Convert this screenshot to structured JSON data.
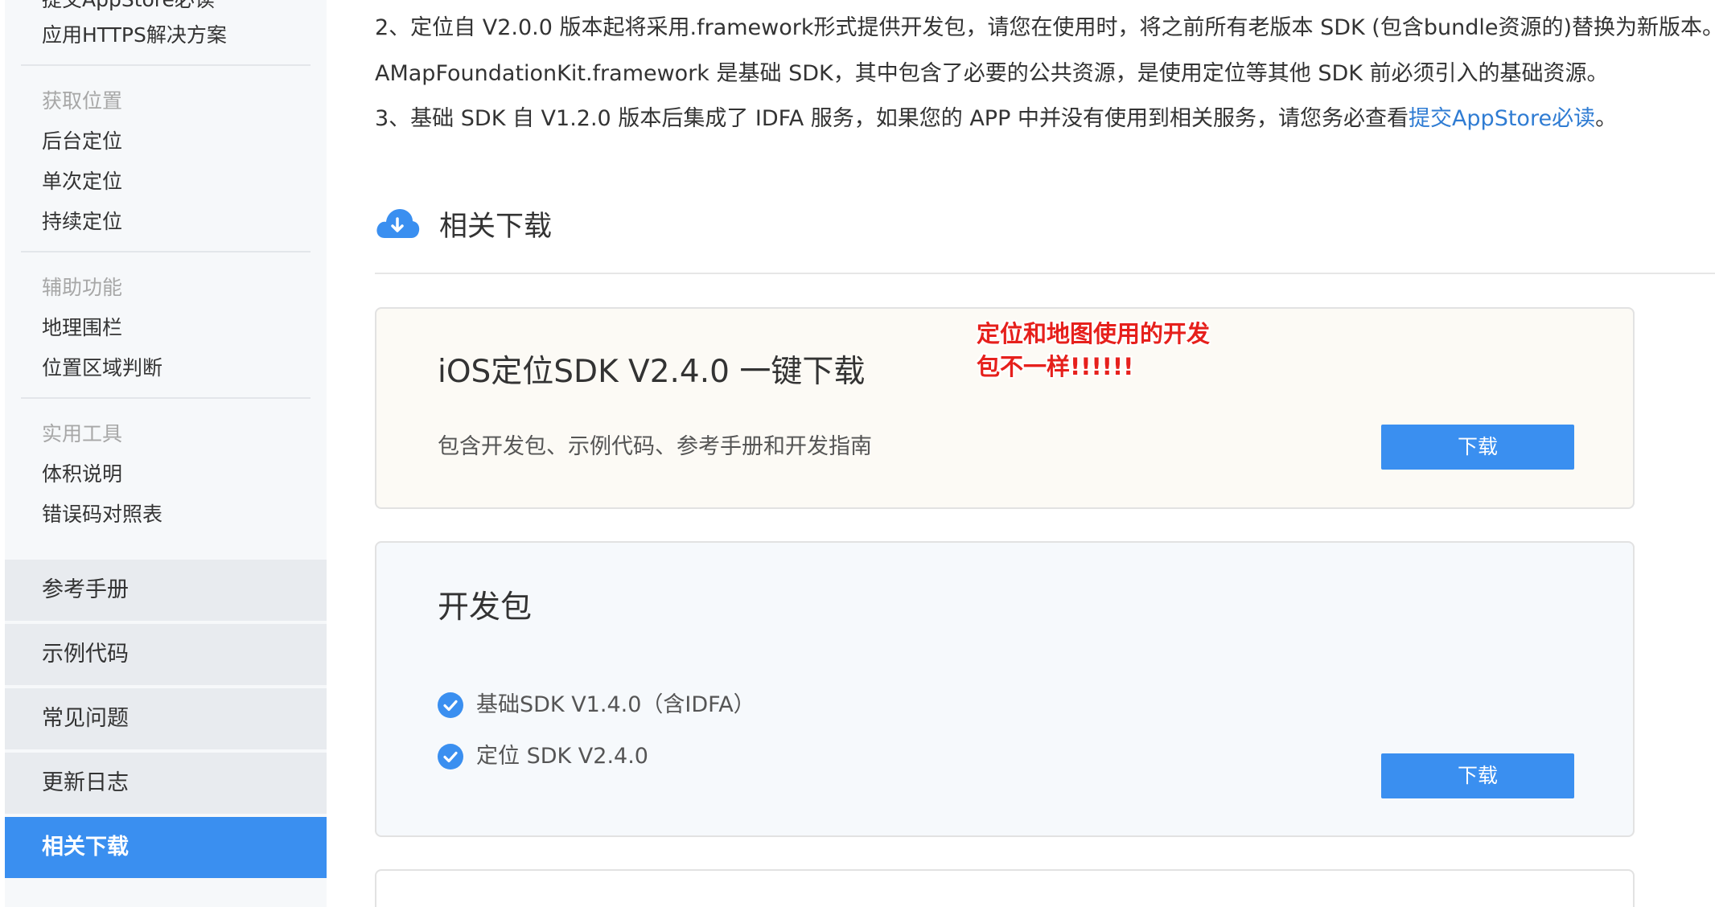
{
  "sidebar": {
    "top_links": [
      "提交AppStore必读",
      "应用HTTPS解决方案"
    ],
    "groups": [
      {
        "heading": "获取位置",
        "items": [
          "后台定位",
          "单次定位",
          "持续定位"
        ]
      },
      {
        "heading": "辅助功能",
        "items": [
          "地理围栏",
          "位置区域判断"
        ]
      },
      {
        "heading": "实用工具",
        "items": [
          "体积说明",
          "错误码对照表"
        ]
      }
    ],
    "blocks": [
      {
        "label": "参考手册",
        "active": false
      },
      {
        "label": "示例代码",
        "active": false
      },
      {
        "label": "常见问题",
        "active": false
      },
      {
        "label": "更新日志",
        "active": false
      },
      {
        "label": "相关下载",
        "active": true
      }
    ]
  },
  "intro": {
    "line1": "2、定位自 V2.0.0 版本起将采用.framework形式提供开发包，请您在使用时，将之前所有老版本 SDK (包含bundle资源的)替换为新版本。",
    "line2": "AMapFoundationKit.framework 是基础 SDK，其中包含了必要的公共资源，是使用定位等其他 SDK 前必须引入的基础资源。",
    "line3_prefix": "3、基础 SDK 自 V1.2.0 版本后集成了 IDFA 服务，如果您的 APP 中并没有使用到相关服务，请您务必查看",
    "line3_link": "提交AppStore必读",
    "line3_suffix": "。"
  },
  "section": {
    "title": "相关下载",
    "icon": "cloud-download-icon"
  },
  "cards": {
    "onekey": {
      "title": "iOS定位SDK V2.4.0 一键下载",
      "description": "包含开发包、示例代码、参考手册和开发指南",
      "button": "下载"
    },
    "devpack": {
      "title": "开发包",
      "items": [
        "基础SDK V1.4.0（含IDFA）",
        "定位 SDK V2.4.0"
      ],
      "button": "下载"
    }
  },
  "annotation": {
    "line1": "定位和地图使用的开发",
    "line2": "包不一样!!!!!!"
  },
  "colors": {
    "accent": "#3a8ff0",
    "link": "#2f7cd3",
    "annotation": "#e6201c",
    "sidebar_bg": "#f6f8fa"
  }
}
